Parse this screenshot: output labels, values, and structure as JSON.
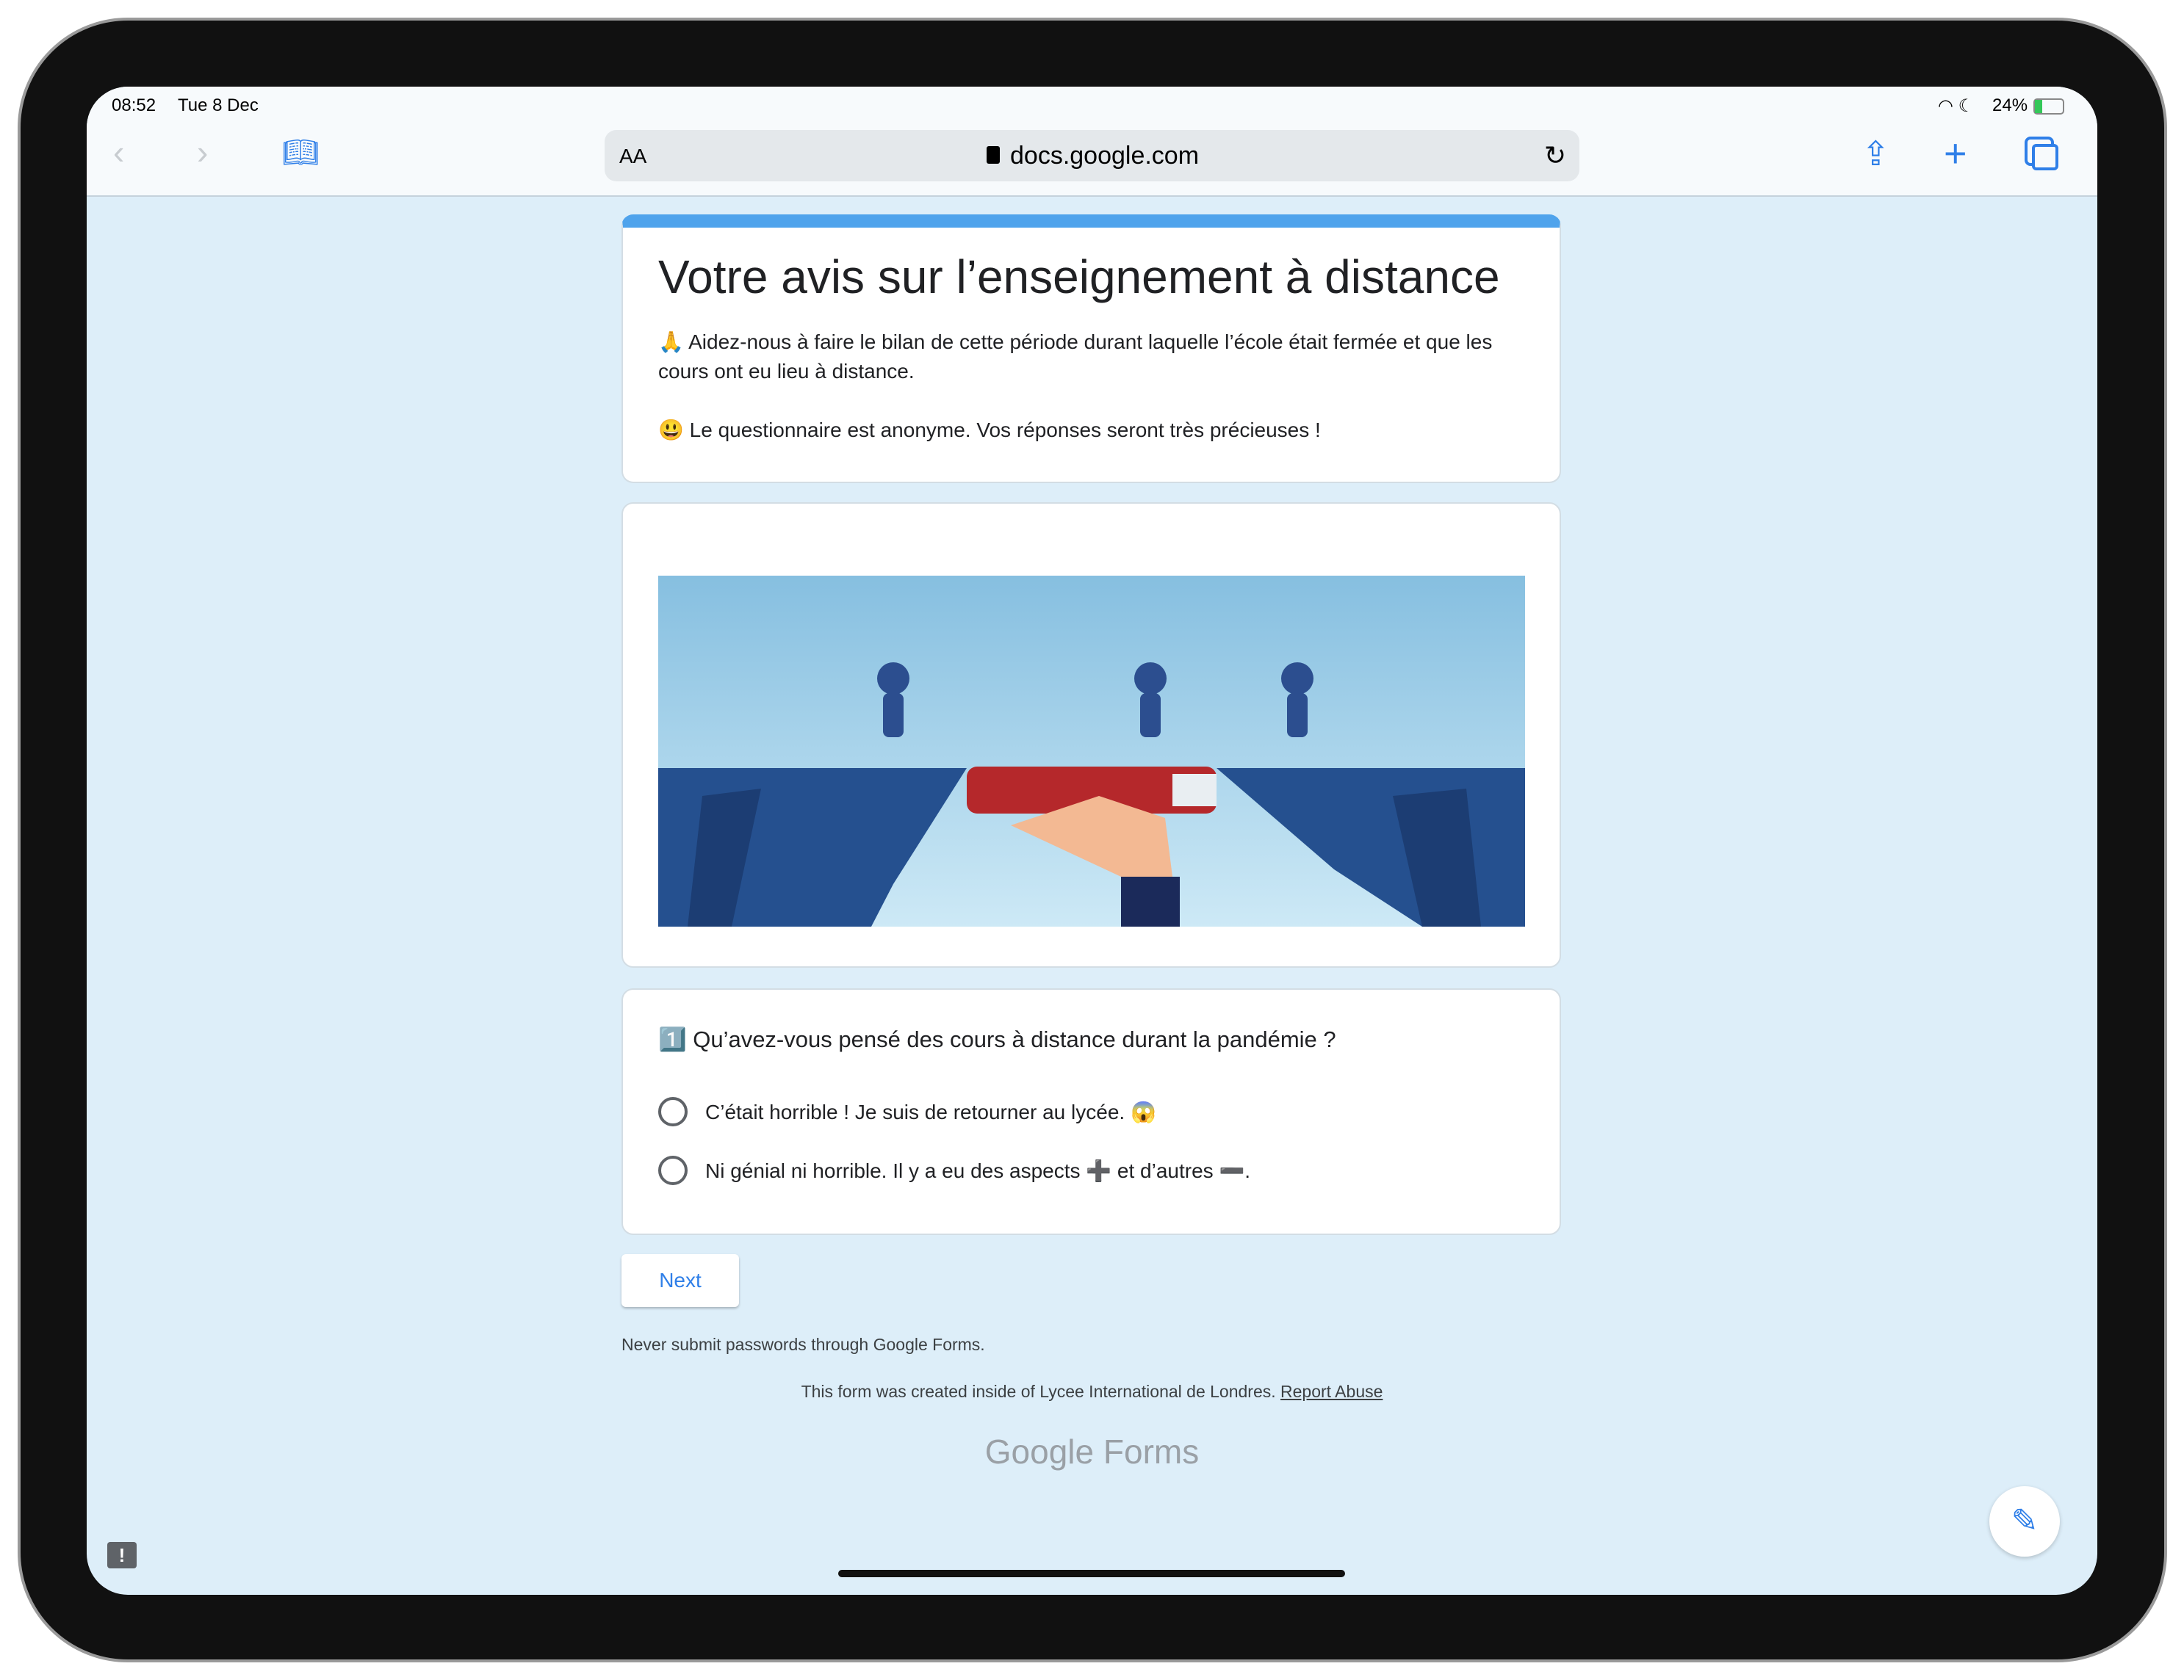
{
  "status": {
    "time": "08:52",
    "date": "Tue 8 Dec",
    "battery": "24%"
  },
  "browser": {
    "text_size": "AA",
    "url": "docs.google.com"
  },
  "form": {
    "title": "Votre avis sur l’enseignement à distance",
    "desc1": "🙏 Aidez-nous à faire le bilan de cette période durant laquelle l’école était fermée et que les cours ont eu lieu à distance.",
    "desc2": "😃 Le questionnaire est anonyme. Vos réponses seront très précieuses !",
    "question": "1️⃣ Qu’avez-vous pensé des cours à distance durant la pandémie ?",
    "options": [
      "C’était horrible ! Je suis de retourner au lycée. 😱",
      "Ni génial ni horrible. Il y a eu des aspects ➕ et d’autres ➖."
    ],
    "next": "Next"
  },
  "footer": {
    "warning": "Never submit passwords through Google Forms.",
    "created": "This form was created inside of Lycee International de Londres.",
    "report": "Report Abuse",
    "logo_google": "Google",
    "logo_forms": "Forms"
  },
  "colors": {
    "accent": "#4fa3ec",
    "link": "#2f7fe8"
  }
}
